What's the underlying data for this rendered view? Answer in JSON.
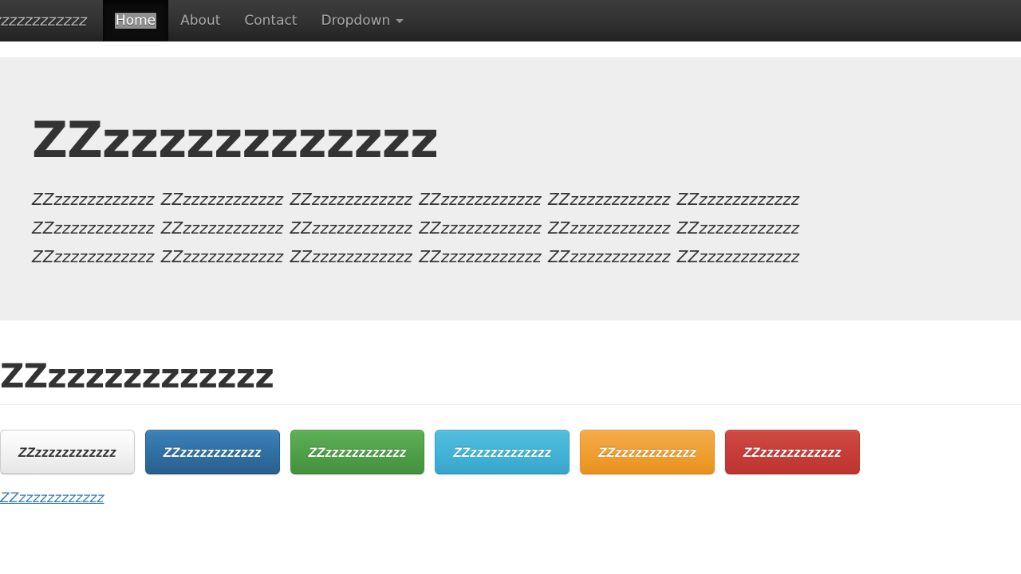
{
  "navbar": {
    "brand": "ZZzzzzzzzzzzzz",
    "items": [
      {
        "label": "Home",
        "active": true
      },
      {
        "label": "About",
        "active": false
      },
      {
        "label": "Contact",
        "active": false
      },
      {
        "label": "Dropdown",
        "active": false,
        "caret": true
      }
    ],
    "caret_icon": "chevron-down-icon",
    "background_color": "#222222",
    "active_background_color": "#0c0c0c",
    "link_color": "#a8a8a8"
  },
  "jumbotron": {
    "heading": "ZZzzzzzzzzzzzz",
    "lead": "ZZzzzzzzzzzzzz ZZzzzzzzzzzzzz ZZzzzzzzzzzzzz ZZzzzzzzzzzzzz ZZzzzzzzzzzzzz ZZzzzzzzzzzzzz ZZzzzzzzzzzzzz ZZzzzzzzzzzzzz ZZzzzzzzzzzzzz ZZzzzzzzzzzzzz ZZzzzzzzzzzzzz ZZzzzzzzzzzzzz ZZzzzzzzzzzzzz ZZzzzzzzzzzzzz ZZzzzzzzzzzzzz ZZzzzzzzzzzzzz ZZzzzzzzzzzzzz ZZzzzzzzzzzzzz",
    "background_color": "#eeeeee"
  },
  "page_header": {
    "heading": "ZZzzzzzzzzzzzz"
  },
  "buttons": [
    {
      "label": "ZZzzzzzzzzzzzz",
      "variant": "default",
      "color": "#e6e6e6"
    },
    {
      "label": "ZZzzzzzzzzzzzz",
      "variant": "primary",
      "color": "#2f6fa3"
    },
    {
      "label": "ZZzzzzzzzzzzzz",
      "variant": "success",
      "color": "#4e9f48"
    },
    {
      "label": "ZZzzzzzzzzzzzz",
      "variant": "info",
      "color": "#42b2d6"
    },
    {
      "label": "ZZzzzzzzzzzzzz",
      "variant": "warning",
      "color": "#ef9e31"
    },
    {
      "label": "ZZzzzzzzzzzzzz",
      "variant": "danger",
      "color": "#c63c37"
    }
  ],
  "footer_link": {
    "label": "ZZzzzzzzzzzzzz",
    "color": "#3a7cb5"
  }
}
